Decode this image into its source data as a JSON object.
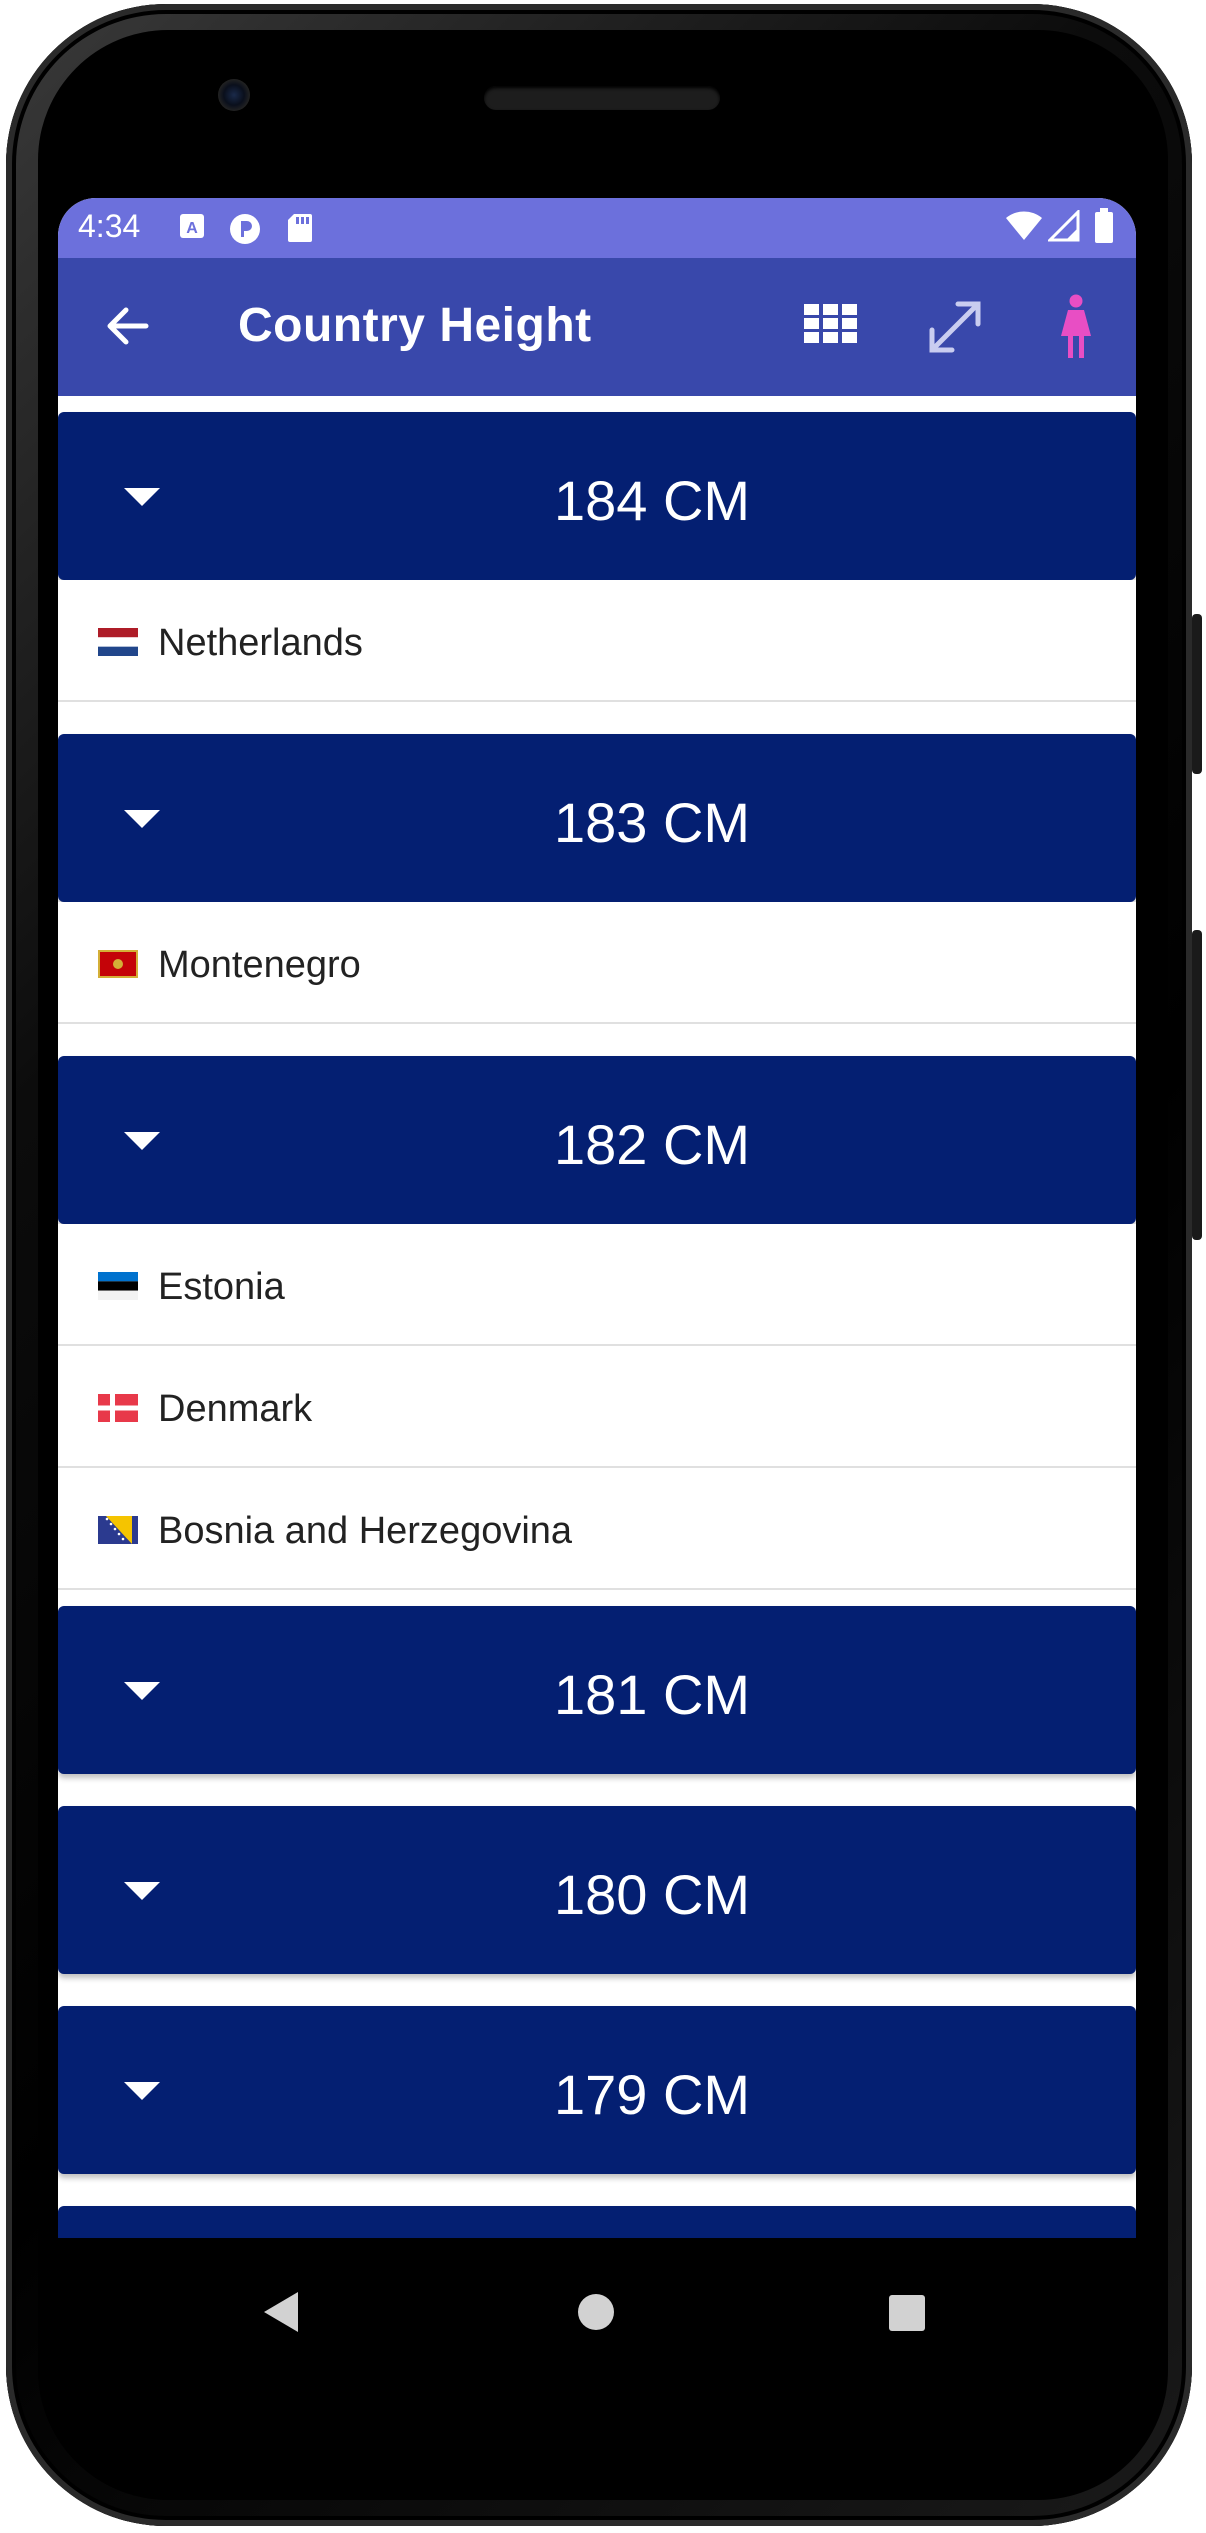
{
  "status": {
    "time": "4:34"
  },
  "appbar": {
    "title": "Country Height"
  },
  "groups": [
    {
      "label": "184 CM",
      "countries": [
        "Netherlands"
      ]
    },
    {
      "label": "183 CM",
      "countries": [
        "Montenegro"
      ]
    },
    {
      "label": "182 CM",
      "countries": [
        "Estonia",
        "Denmark",
        "Bosnia and Herzegovina"
      ]
    },
    {
      "label": "181 CM",
      "countries": []
    },
    {
      "label": "180 CM",
      "countries": []
    },
    {
      "label": "179 CM",
      "countries": []
    }
  ],
  "colors": {
    "status_bar": "#6c70dc",
    "app_bar": "#3948ab",
    "group_header": "#041f72",
    "female_icon": "#e84ec4"
  },
  "icons": {
    "back": "arrow-left-icon",
    "grid": "grid-icon",
    "expand": "expand-arrows-icon",
    "gender": "female-person-icon"
  }
}
